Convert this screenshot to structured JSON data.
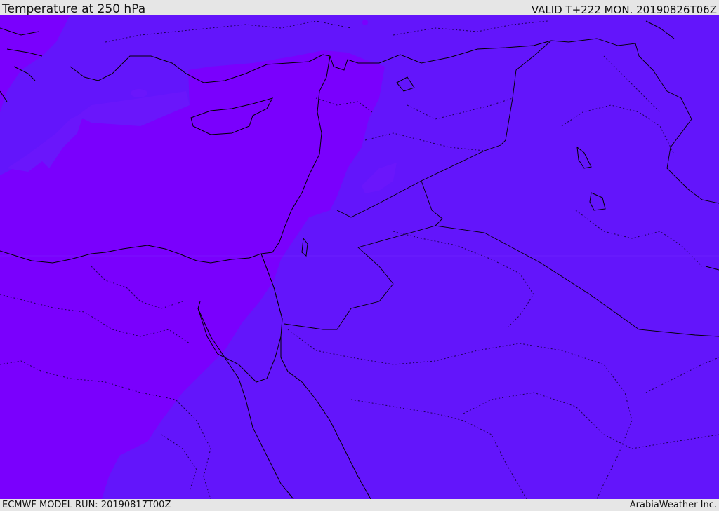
{
  "header": {
    "title": "Temperature at 250 hPa",
    "valid": "VALID T+222 MON. 20190826T06Z"
  },
  "footer": {
    "model_run": "ECMWF MODEL RUN: 20190817T00Z",
    "brand": "ArabiaWeather Inc."
  },
  "map": {
    "colors": {
      "background": "#6315fb",
      "warm_region": "#7a00fd",
      "mid_region": "#6b10fc",
      "coast_line": "#000000",
      "border_dotted": "#1a0050"
    }
  }
}
